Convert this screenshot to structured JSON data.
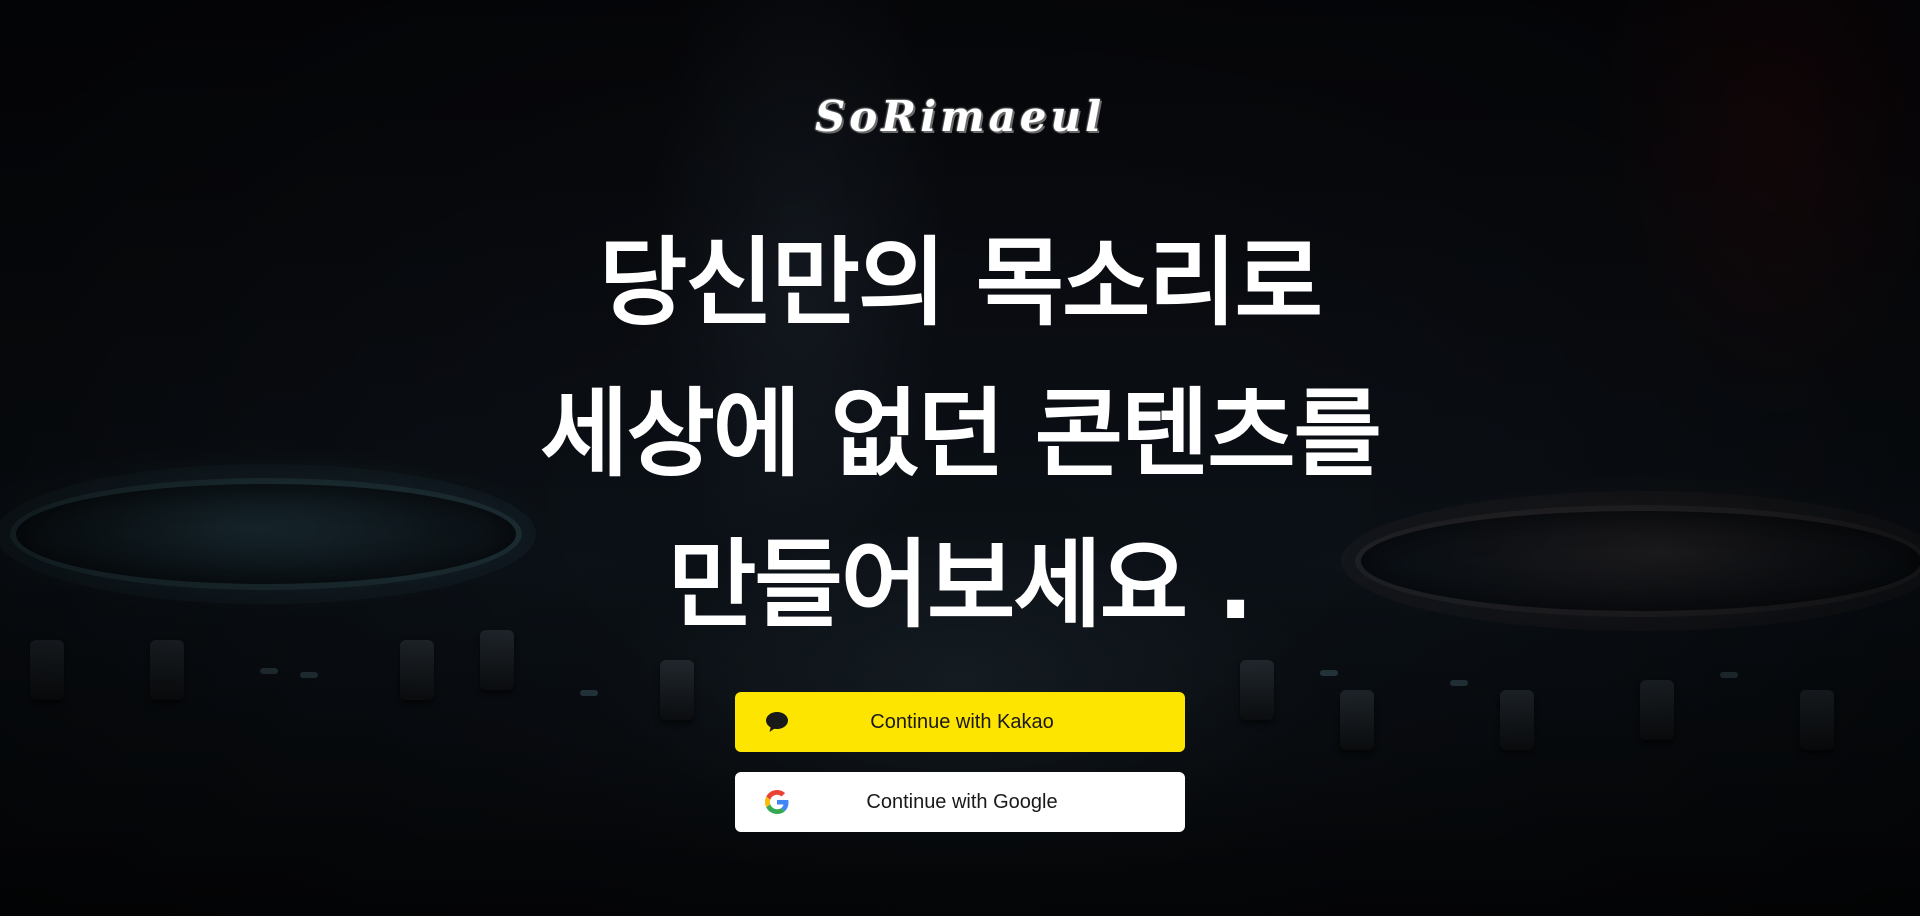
{
  "logo": {
    "text": "SoRimaeul"
  },
  "headline": {
    "lines": [
      "당신만의 목소리로",
      "세상에 없던 콘텐츠를",
      "만들어보세요 ."
    ]
  },
  "buttons": {
    "kakao": {
      "label": "Continue with Kakao",
      "icon": "kakao-speech-bubble-icon",
      "background": "#fee500"
    },
    "google": {
      "label": "Continue with Google",
      "icon": "google-g-icon",
      "background": "#ffffff"
    }
  }
}
